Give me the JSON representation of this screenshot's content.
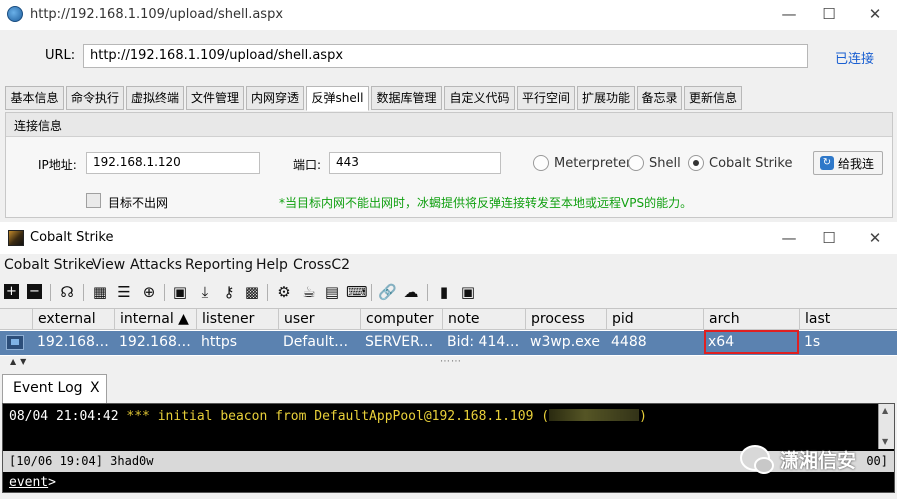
{
  "browser": {
    "title": "http://192.168.1.109/upload/shell.aspx",
    "url_label": "URL:",
    "url_value": "http://192.168.1.109/upload/shell.aspx",
    "status": "已连接"
  },
  "tabs": [
    "基本信息",
    "命令执行",
    "虚拟终端",
    "文件管理",
    "内网穿透",
    "反弹shell",
    "数据库管理",
    "自定义代码",
    "平行空间",
    "扩展功能",
    "备忘录",
    "更新信息"
  ],
  "active_tab": "反弹shell",
  "panel": {
    "title": "连接信息",
    "ip_label": "IP地址:",
    "ip_value": "192.168.1.120",
    "port_label": "端口:",
    "port_value": "443",
    "radio_meterpreter": "Meterpreter",
    "radio_shell": "Shell",
    "radio_cobalt": "Cobalt Strike",
    "selected": "Cobalt Strike",
    "connect_button": "给我连",
    "no_outbound_label": "目标不出网",
    "hint": "*当目标内网不能出网时，冰蝎提供将反弹连接转发至本地或远程VPS的能力。"
  },
  "cs": {
    "title": "Cobalt Strike",
    "menus": [
      "Cobalt Strike",
      "View",
      "Attacks",
      "Reporting",
      "Help",
      "CrossC2"
    ],
    "toolbar_icons": [
      "plus-icon",
      "minus-icon",
      "headphones-icon",
      "pivot-graph-icon",
      "session-list-icon",
      "target-icon",
      "credentials-icon",
      "download-icon",
      "key-icon",
      "screenshot-icon",
      "settings-icon",
      "coffee-icon",
      "document-icon",
      "console-icon",
      "link-icon",
      "cloud-icon",
      "book-icon",
      "cube-icon"
    ],
    "columns": [
      "",
      "external",
      "internal ▲",
      "listener",
      "user",
      "computer",
      "note",
      "process",
      "pid",
      "arch",
      "last"
    ],
    "row": {
      "external": "192.168.…",
      "internal": "192.168.…",
      "listener": "https",
      "user": "DefaultAp…",
      "computer": "SERVER-…",
      "note": "Bid: 4145…",
      "process": "w3wp.exe",
      "pid": "4488",
      "arch": "x64",
      "last": "1s"
    },
    "event_tab": "Event Log",
    "event_tab_close": "X",
    "log_time": "08/04 21:04:42",
    "log_stars": "***",
    "log_text": " initial beacon from DefaultAppPool@192.168.1.109 (",
    "log_close": ")",
    "status_left": "[10/06 19:04] 3had0w",
    "status_right": "00]",
    "prompt_word": "event",
    "prompt_symbol": ">",
    "watermark": "潇湘信安",
    "highlight_color": "#e02020"
  }
}
